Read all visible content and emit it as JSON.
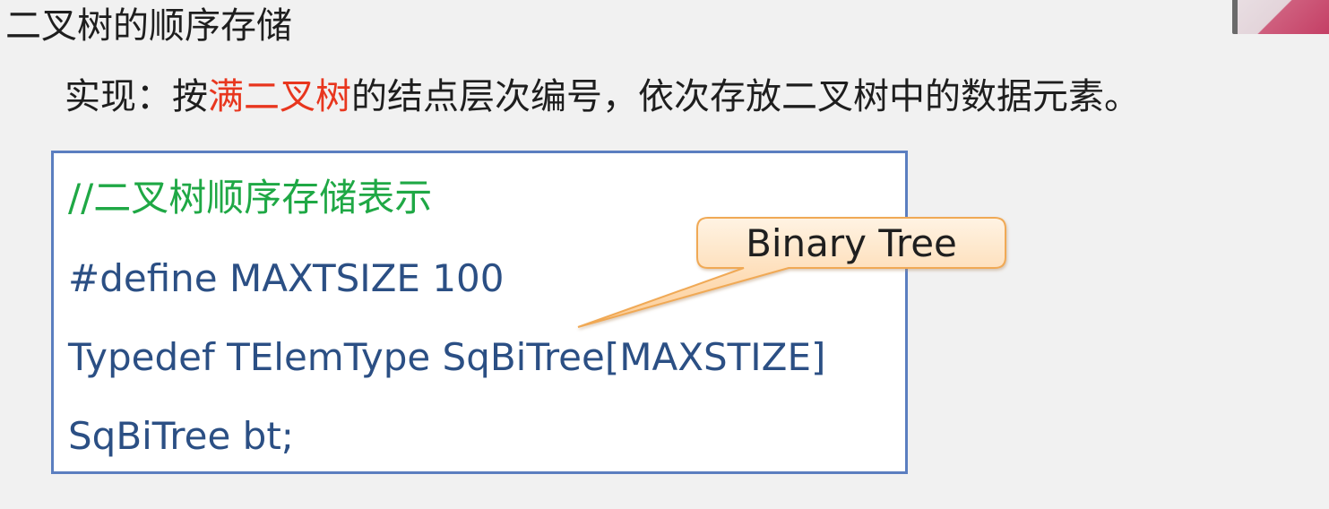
{
  "slide": {
    "title": "二叉树的顺序存储",
    "intro_prefix": "实现：按",
    "intro_highlight": "满二叉树",
    "intro_suffix": "的结点层次编号，依次存放二叉树中的数据元素。"
  },
  "code_box": {
    "comment": "//二叉树顺序存储表示",
    "lines": [
      "#define MAXTSIZE 100",
      "Typedef TElemType SqBiTree[MAXSTIZE]",
      "SqBiTree bt;"
    ]
  },
  "callout": {
    "label": "Binary Tree"
  },
  "colors": {
    "background": "#f1f1f1",
    "highlight_text": "#e8361e",
    "comment_green": "#1fa845",
    "code_blue": "#2b4f84",
    "box_border": "#5b7ec0",
    "callout_fill_top": "#fff3e3",
    "callout_fill_bottom": "#fccb93",
    "callout_border": "#f0a955"
  },
  "presenter_video": {
    "icon": "presenter-video-thumbnail"
  }
}
